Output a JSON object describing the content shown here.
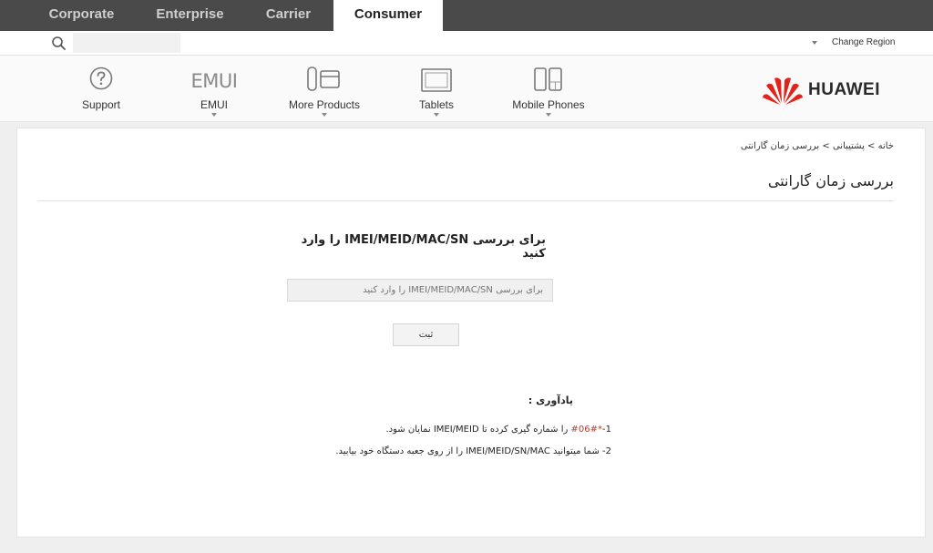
{
  "colors": {
    "topbar_bg": "#4a4a4a",
    "active_tab_bg": "#ffffff",
    "brand_red": "#e2231a",
    "code_red": "#c0392b"
  },
  "top_tabs": [
    {
      "label": "Corporate",
      "active": false
    },
    {
      "label": "Enterprise",
      "active": false
    },
    {
      "label": "Carrier",
      "active": false
    },
    {
      "label": "Consumer",
      "active": true
    }
  ],
  "search": {
    "icon": "search-icon",
    "placeholder": "",
    "value": ""
  },
  "region": {
    "label": "Change Region",
    "icon": "caret-down-icon"
  },
  "nav": {
    "items": [
      {
        "label": "Support",
        "icon": "question-circle-icon",
        "has_dropdown": false
      },
      {
        "label": "EMUI",
        "icon": "emui-logo-icon",
        "icon_text": "EMUI",
        "has_dropdown": true
      },
      {
        "label": "More Products",
        "icon": "more-products-icon",
        "has_dropdown": true
      },
      {
        "label": "Tablets",
        "icon": "tablet-icon",
        "has_dropdown": true
      },
      {
        "label": "Mobile Phones",
        "icon": "mobile-phone-icon",
        "has_dropdown": true
      }
    ],
    "logo_text": "HUAWEI"
  },
  "breadcrumb": "خانه > پشتیبانی > بررسی زمان گارانتی",
  "page_title": "بررسی زمان گارانتی",
  "form": {
    "prompt": "برای بررسی IMEI/MEID/MAC/SN را وارد کنید",
    "input_placeholder": "برای بررسی IMEI/MEID/MAC/SN را وارد کنید",
    "submit_label": "ثبت"
  },
  "notes": {
    "title": "یادآوری :",
    "note1_prefix": "1-",
    "note1_code": "*#06#",
    "note1_text": " را شماره گیری کرده تا IMEI/MEID نمایان شود.",
    "note2": "2- شما میتوانید IMEI/MEID/SN/MAC را از روی جعبه دستگاه خود بیابید."
  }
}
